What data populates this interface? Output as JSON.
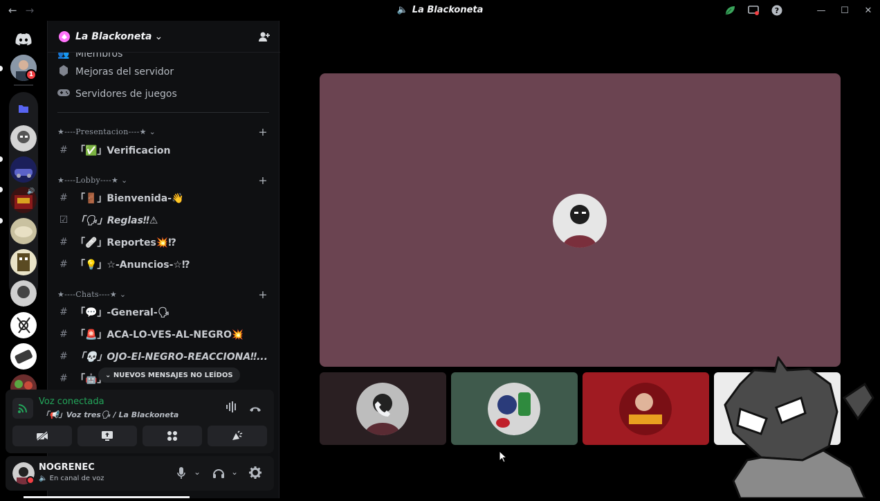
{
  "titlebar": {
    "back": "←",
    "forward": "→",
    "title": "La Blackoneta",
    "icons": [
      "leaf-icon",
      "screen-icon",
      "help-icon"
    ]
  },
  "window_controls": [
    "minimize",
    "maximize",
    "close"
  ],
  "server": {
    "name": "La Blackoneta",
    "chevron": "⌄",
    "partial_item": "Miembros",
    "boosts": "Mejoras del servidor",
    "game_servers": "Servidores de juegos"
  },
  "categories": [
    {
      "label": "★----Presentacion----★ ⌄"
    },
    {
      "label": "★----Lobby----★ ⌄"
    },
    {
      "label": "★----Chats----★ ⌄"
    }
  ],
  "channels": {
    "verificacion": "「✅」Verificacion",
    "bienvenida": "「🚪」Bienvenida-👋",
    "reglas": "「🗣」Reglas‼⚠",
    "reportes": "「🩹」Reportes💥⁉",
    "anuncios": "「💡」☆-Anuncios-☆⁉",
    "general": "「💬」-General-🗣",
    "aca": "「🚨」ACA-LO-VES-AL-NEGRO💥",
    "ojo": "「💀」OJO-El-NEGRO-REACCIONA‼...",
    "partial": "「🤖」"
  },
  "unread_pill": "⌄  NUEVOS MENSAJES NO LEÍDOS",
  "voice_panel": {
    "status": "Voz conectada",
    "channel": "「📢」Voz tres🗣 / La Blackoneta"
  },
  "user_panel": {
    "name": "NOGRENEC",
    "status": "En canal de voz"
  },
  "guild_badge": "1",
  "colors": {
    "voice_green": "#23a55a",
    "stage_bg": "#6b4451",
    "badge_red": "#f23f43"
  }
}
